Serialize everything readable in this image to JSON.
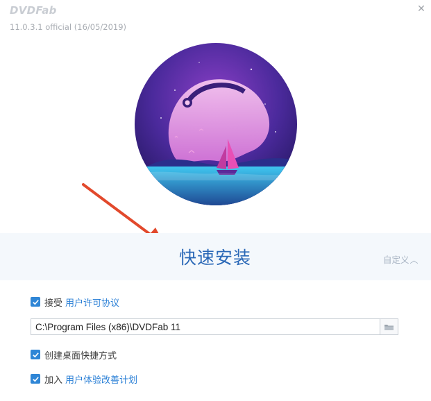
{
  "app": {
    "logo_text": "DVDFab",
    "version": "11.0.3.1 official (16/05/2019)"
  },
  "window": {
    "close_icon": "close-icon"
  },
  "install": {
    "quick_install_label": "快速安装",
    "custom_label": "自定义"
  },
  "license": {
    "checked": true,
    "prefix": "接受",
    "link_text": "用户许可协议"
  },
  "install_path": {
    "value": "C:\\Program Files (x86)\\DVDFab 11"
  },
  "shortcut": {
    "checked": true,
    "label": "创建桌面快捷方式"
  },
  "experience": {
    "checked": true,
    "prefix": "加入",
    "link_text": "用户体验改善计划"
  },
  "colors": {
    "accent": "#2f86d6",
    "link": "#2a7fd6",
    "title": "#2a68b7",
    "arrow": "#e2492c"
  }
}
